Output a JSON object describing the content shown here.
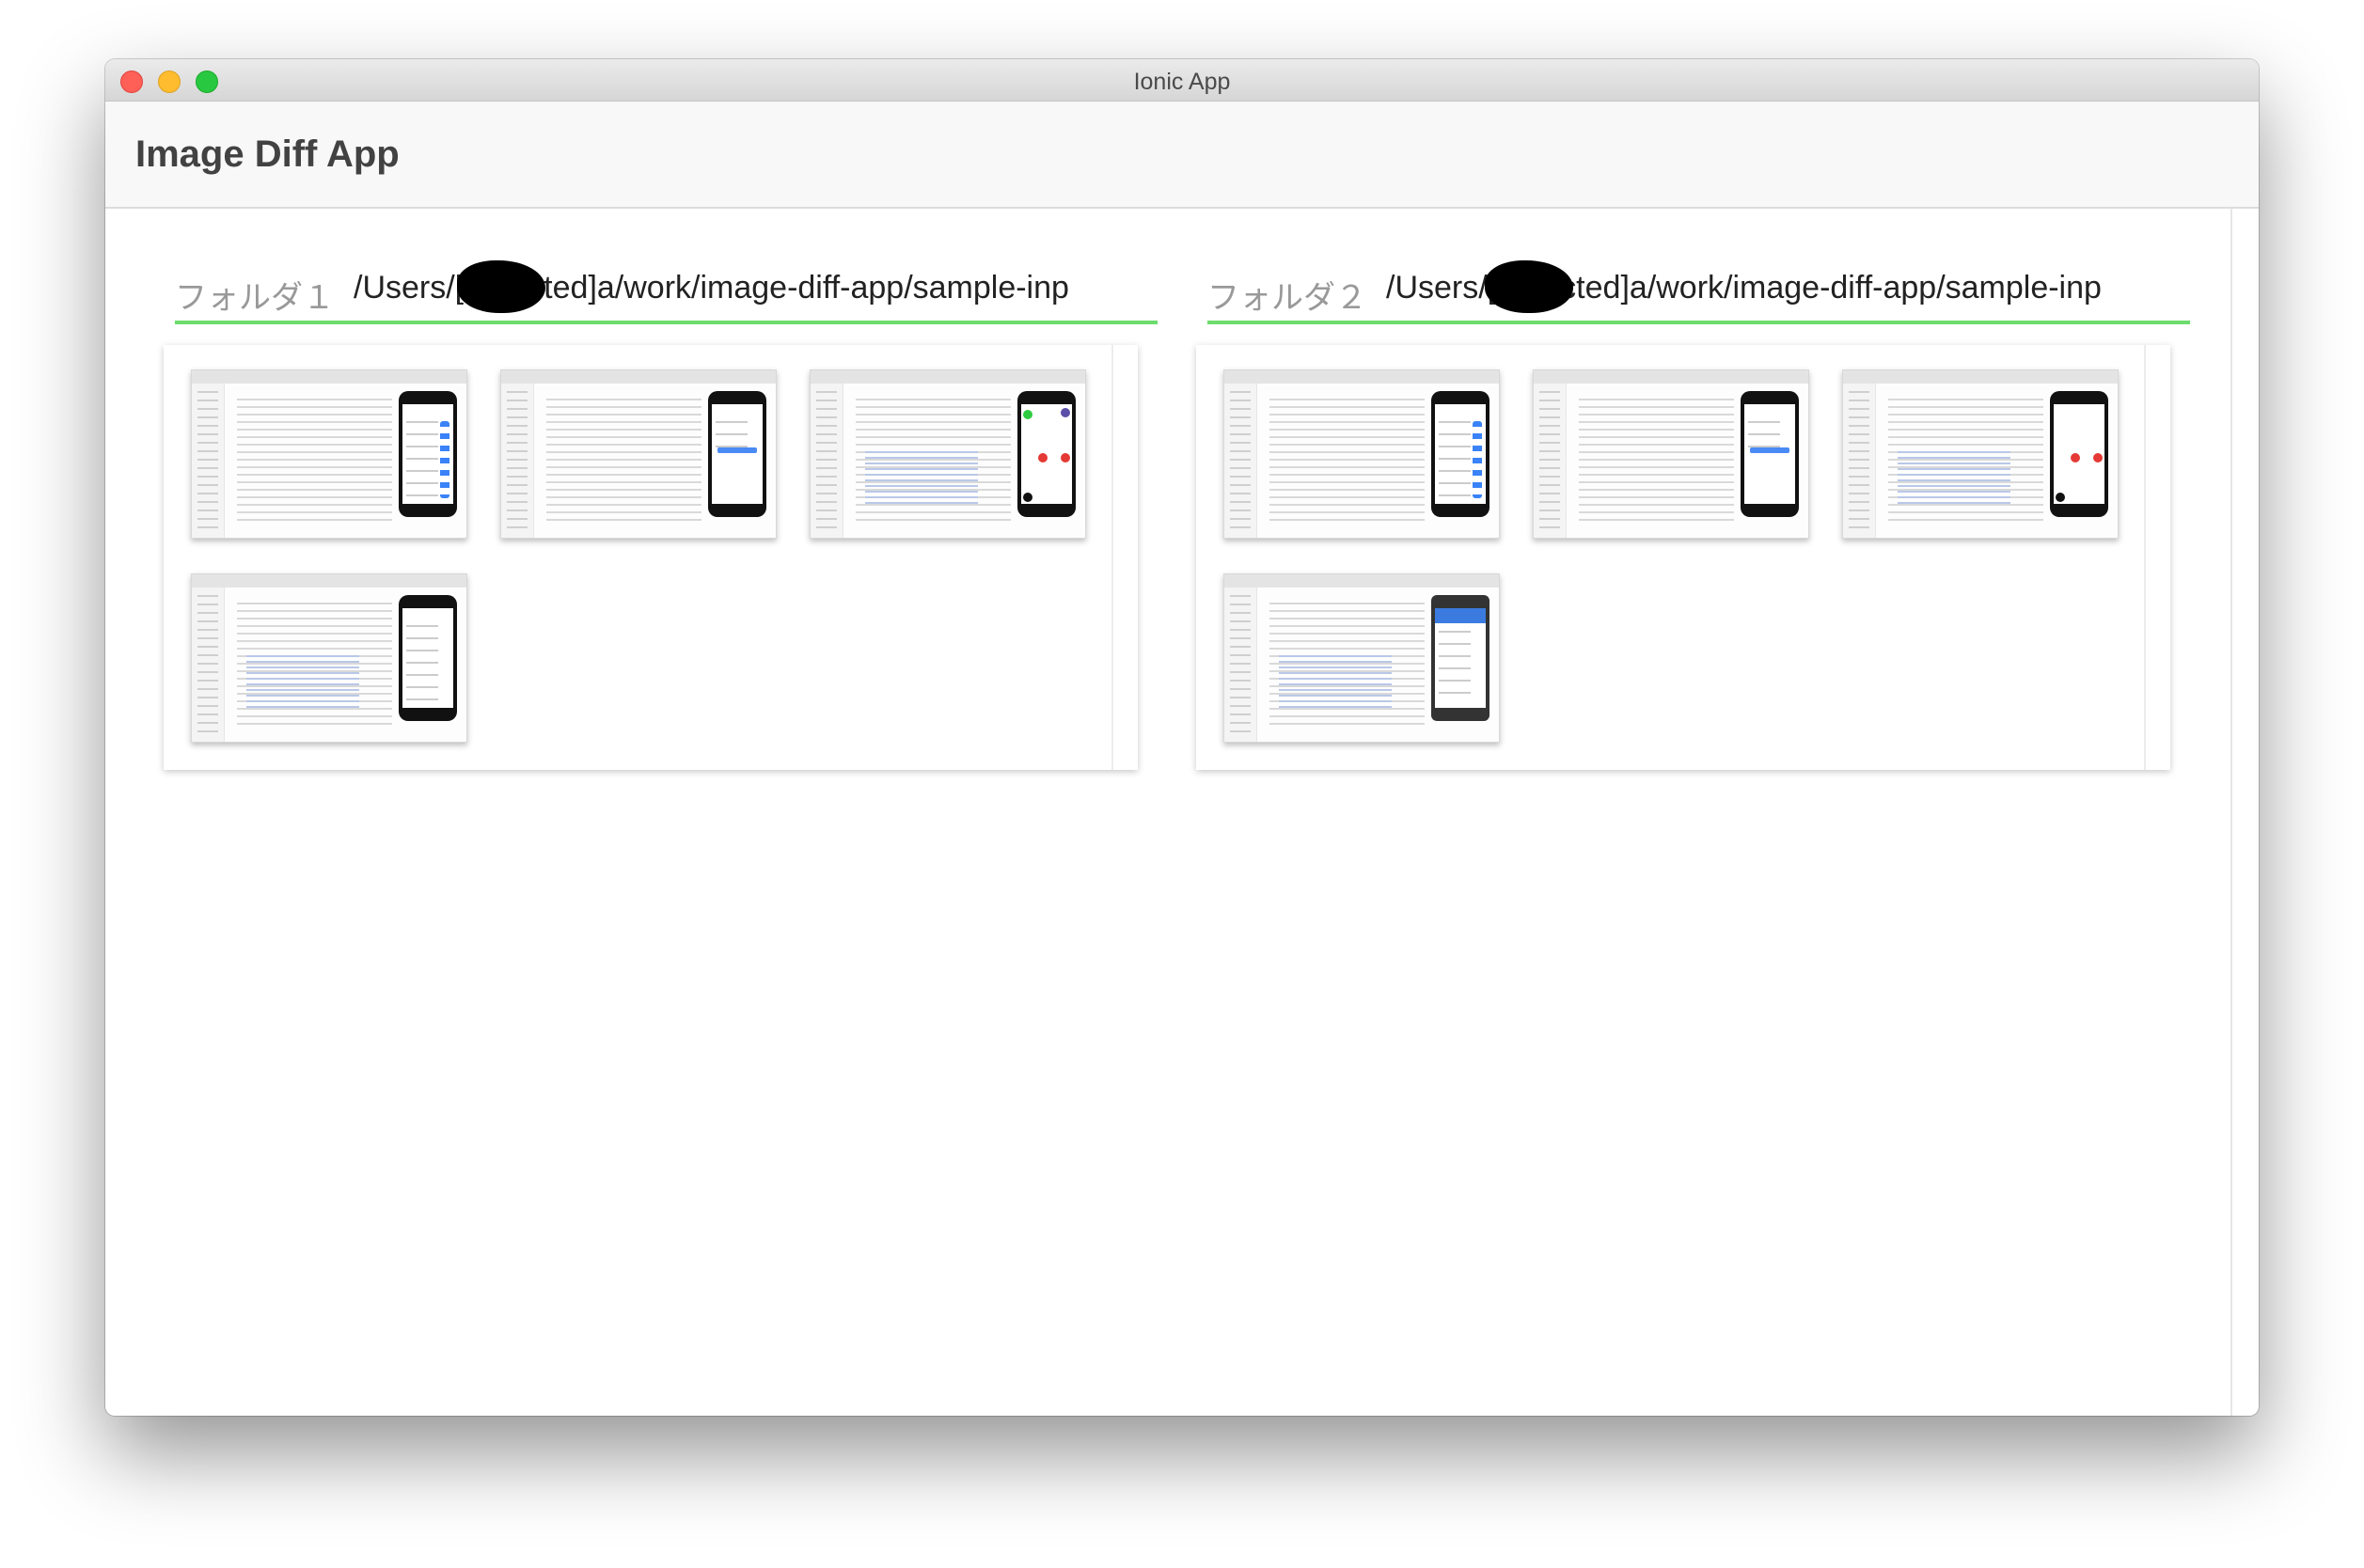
{
  "window": {
    "title": "Ionic App",
    "controls": [
      "close",
      "minimize",
      "maximize"
    ]
  },
  "toolbar": {
    "title": "Image Diff App"
  },
  "folders": [
    {
      "label": "フォルダ１",
      "path": "/Users/[redacted]a/work/image-diff-app/sample-input-data",
      "images": [
        {
          "icon": "toggle-doc-thumbnail"
        },
        {
          "icon": "inputs-doc-thumbnail"
        },
        {
          "icon": "fab-doc-thumbnail"
        },
        {
          "icon": "grid-doc-thumbnail"
        }
      ]
    },
    {
      "label": "フォルダ２",
      "path": "/Users/[redacted]a/work/image-diff-app/sample-input-data",
      "images": [
        {
          "icon": "toggle-doc-thumbnail"
        },
        {
          "icon": "inputs-doc-thumbnail"
        },
        {
          "icon": "fab-doc-thumbnail"
        },
        {
          "icon": "grid-doc-android-thumbnail"
        }
      ]
    }
  ],
  "colors": {
    "accent_underline": "#6ddc6d",
    "toolbar_bg": "#f8f8f8",
    "title_text": "#424242"
  }
}
